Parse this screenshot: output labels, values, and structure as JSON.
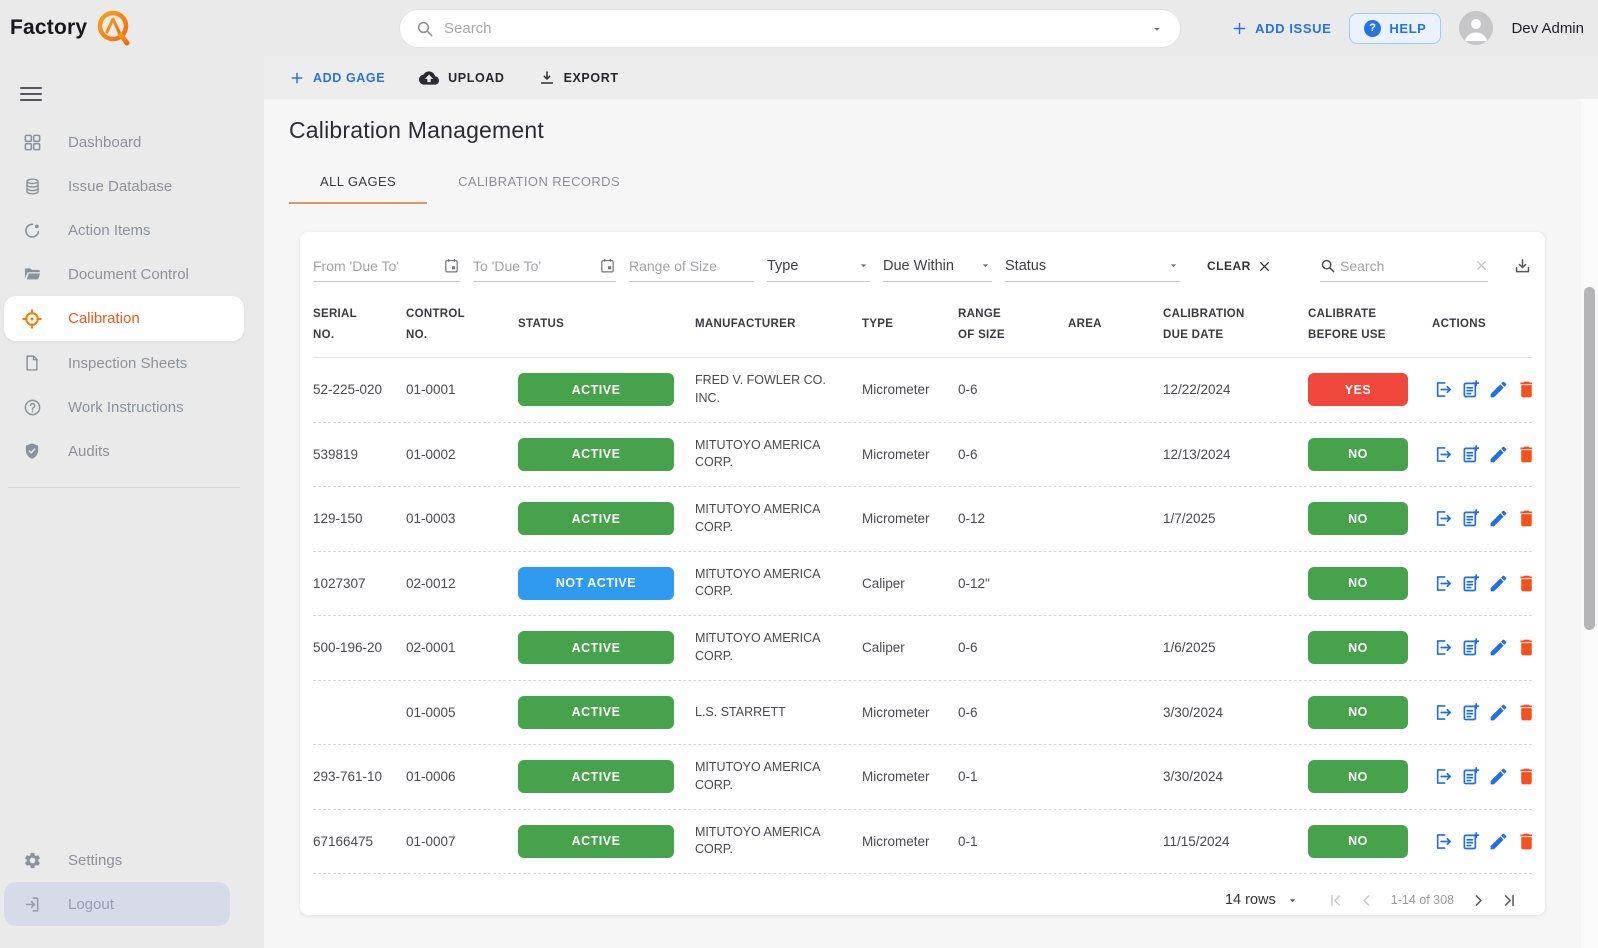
{
  "topbar": {
    "logo_text": "Factory",
    "search_placeholder": "Search",
    "add_issue_label": "ADD ISSUE",
    "help_label": "HELP",
    "user_name": "Dev Admin"
  },
  "sidebar": {
    "items": [
      {
        "label": "Dashboard",
        "icon": "dashboard-icon",
        "active": false
      },
      {
        "label": "Issue Database",
        "icon": "database-icon",
        "active": false
      },
      {
        "label": "Action Items",
        "icon": "action-items-icon",
        "active": false
      },
      {
        "label": "Document Control",
        "icon": "folder-icon",
        "active": false
      },
      {
        "label": "Calibration",
        "icon": "target-icon",
        "active": true
      },
      {
        "label": "Inspection Sheets",
        "icon": "document-icon",
        "active": false
      },
      {
        "label": "Work Instructions",
        "icon": "question-circle-icon",
        "active": false
      },
      {
        "label": "Audits",
        "icon": "shield-icon",
        "active": false
      }
    ],
    "settings_label": "Settings",
    "logout_label": "Logout"
  },
  "toolbar": {
    "add_gage_label": "ADD GAGE",
    "upload_label": "UPLOAD",
    "export_label": "EXPORT"
  },
  "page": {
    "title": "Calibration Management",
    "tabs": [
      {
        "label": "ALL GAGES",
        "active": true
      },
      {
        "label": "CALIBRATION RECORDS",
        "active": false
      }
    ]
  },
  "filters": {
    "from_placeholder": "From 'Due To'",
    "to_placeholder": "To 'Due To'",
    "range_placeholder": "Range of Size",
    "type_label": "Type",
    "due_within_label": "Due Within",
    "status_label": "Status",
    "clear_label": "CLEAR",
    "search_placeholder": "Search"
  },
  "table": {
    "columns": [
      [
        "SERIAL",
        "NO."
      ],
      [
        "CONTROL",
        "NO."
      ],
      [
        "STATUS"
      ],
      [
        "MANUFACTURER"
      ],
      [
        "TYPE"
      ],
      [
        "RANGE",
        "OF SIZE"
      ],
      [
        "AREA"
      ],
      [
        "CALIBRATION",
        "DUE DATE"
      ],
      [
        "CALIBRATE",
        "BEFORE USE"
      ],
      [
        "ACTIONS"
      ]
    ],
    "rows": [
      {
        "serial": "52-225-020",
        "control": "01-0001",
        "status": "ACTIVE",
        "status_color": "green",
        "manufacturer": "FRED V. FOWLER CO. INC.",
        "type": "Micrometer",
        "range": "0-6",
        "area": "",
        "due_date": "12/22/2024",
        "calibrate_before_use": "YES",
        "cbu_color": "red"
      },
      {
        "serial": "539819",
        "control": "01-0002",
        "status": "ACTIVE",
        "status_color": "green",
        "manufacturer": "MITUTOYO AMERICA CORP.",
        "type": "Micrometer",
        "range": "0-6",
        "area": "",
        "due_date": "12/13/2024",
        "calibrate_before_use": "NO",
        "cbu_color": "green"
      },
      {
        "serial": "129-150",
        "control": "01-0003",
        "status": "ACTIVE",
        "status_color": "green",
        "manufacturer": "MITUTOYO AMERICA CORP.",
        "type": "Micrometer",
        "range": "0-12",
        "area": "",
        "due_date": "1/7/2025",
        "calibrate_before_use": "NO",
        "cbu_color": "green"
      },
      {
        "serial": "1027307",
        "control": "02-0012",
        "status": "NOT ACTIVE",
        "status_color": "blue",
        "manufacturer": "MITUTOYO AMERICA CORP.",
        "type": "Caliper",
        "range": "0-12\"",
        "area": "",
        "due_date": "",
        "calibrate_before_use": "NO",
        "cbu_color": "green"
      },
      {
        "serial": "500-196-20",
        "control": "02-0001",
        "status": "ACTIVE",
        "status_color": "green",
        "manufacturer": "MITUTOYO AMERICA CORP.",
        "type": "Caliper",
        "range": "0-6",
        "area": "",
        "due_date": "1/6/2025",
        "calibrate_before_use": "NO",
        "cbu_color": "green"
      },
      {
        "serial": "",
        "control": "01-0005",
        "status": "ACTIVE",
        "status_color": "green",
        "manufacturer": "L.S. STARRETT",
        "type": "Micrometer",
        "range": "0-6",
        "area": "",
        "due_date": "3/30/2024",
        "calibrate_before_use": "NO",
        "cbu_color": "green"
      },
      {
        "serial": "293-761-10",
        "control": "01-0006",
        "status": "ACTIVE",
        "status_color": "green",
        "manufacturer": "MITUTOYO AMERICA CORP.",
        "type": "Micrometer",
        "range": "0-1",
        "area": "",
        "due_date": "3/30/2024",
        "calibrate_before_use": "NO",
        "cbu_color": "green"
      },
      {
        "serial": "67166475",
        "control": "01-0007",
        "status": "ACTIVE",
        "status_color": "green",
        "manufacturer": "MITUTOYO AMERICA CORP.",
        "type": "Micrometer",
        "range": "0-1",
        "area": "",
        "due_date": "11/15/2024",
        "calibrate_before_use": "NO",
        "cbu_color": "green"
      }
    ]
  },
  "pagination": {
    "rows_per_page_label": "14 rows",
    "range_label": "1-14 of 308"
  },
  "colors": {
    "active_green": "#46a34c",
    "alert_red": "#f0473d",
    "not_active_blue": "#2e9bf0",
    "accent_blue": "#2574e0",
    "accent_orange": "#f5581c",
    "trash_orange": "#f4511e"
  }
}
